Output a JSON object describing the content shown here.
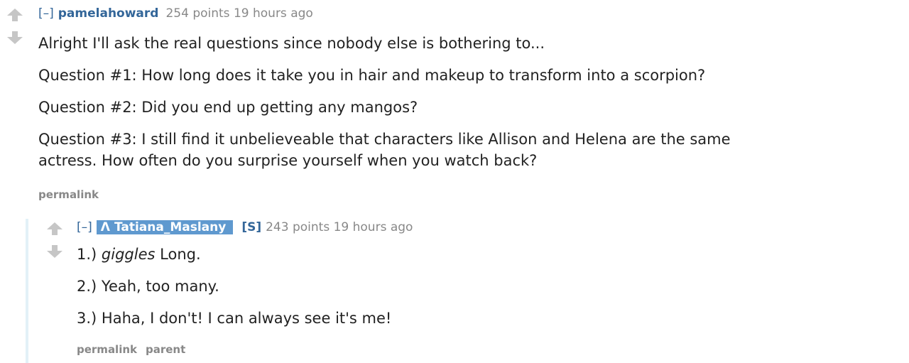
{
  "comment": {
    "collapse": "[–]",
    "author": "pamelahoward",
    "score": "254 points",
    "time": "19 hours ago",
    "lines": [
      "Alright I'll ask the real questions since nobody else is bothering to...",
      "Question #1: How long does it take you in hair and makeup to transform into a scorpion?",
      "Question #2: Did you end up getting any mangos?",
      "Question #3: I still find it unbelieveable that characters like Allison and Helena are the same",
      "actress. How often do you surprise yourself when you watch back?"
    ],
    "permalink": "permalink"
  },
  "reply": {
    "collapse": "[–]",
    "author": "Tatiana_Maslany",
    "author_badge_icon": "verified-a-icon",
    "submitter": "[S]",
    "score": "243 points",
    "time": "19 hours ago",
    "line1_prefix": "1.)",
    "line1_emphasis": "giggles",
    "line1_suffix": "Long.",
    "line2": "2.) Yeah, too many.",
    "line3": "3.) Haha, I don't! I can always see it's me!",
    "permalink": "permalink",
    "parent": "parent"
  },
  "colors": {
    "link": "#336699",
    "badge_bg": "#5f99cf",
    "arrow": "#c6c6c6",
    "muted": "#888888",
    "thread_line": "#e2f1f7"
  }
}
